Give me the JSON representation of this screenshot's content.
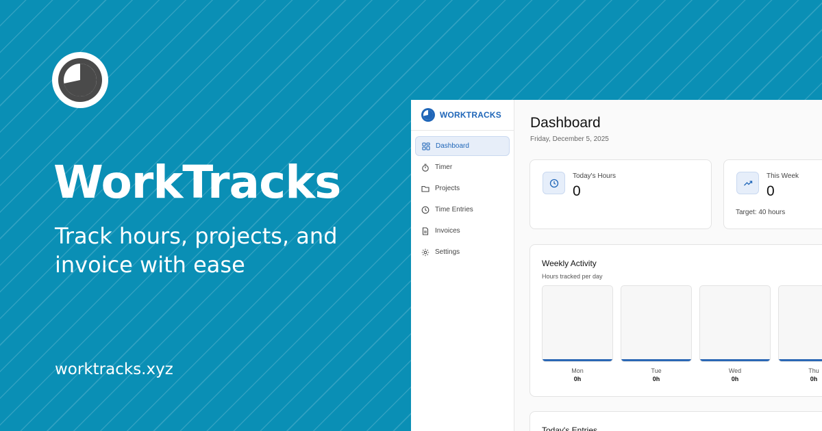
{
  "promo": {
    "brand": "WorkTracks",
    "tagline": "Track hours, projects, and invoice with ease",
    "site": "worktracks.xyz",
    "logo_icon": "clock-logo-icon"
  },
  "app": {
    "sidebar": {
      "title": "WORKTRACKS",
      "items": [
        {
          "label": "Dashboard",
          "icon": "grid-icon",
          "active": true
        },
        {
          "label": "Timer",
          "icon": "stopwatch-icon"
        },
        {
          "label": "Projects",
          "icon": "folder-icon"
        },
        {
          "label": "Time Entries",
          "icon": "clock-icon"
        },
        {
          "label": "Invoices",
          "icon": "document-icon"
        },
        {
          "label": "Settings",
          "icon": "gear-icon"
        }
      ]
    },
    "header": {
      "title": "Dashboard",
      "date": "Friday, December 5, 2025"
    },
    "stats": [
      {
        "label": "Today's Hours",
        "value": "0",
        "icon": "clock-icon"
      },
      {
        "label": "This Week",
        "value": "0",
        "sub": "Target: 40 hours",
        "icon": "trend-up-icon"
      }
    ],
    "weekly": {
      "title": "Weekly Activity",
      "subtitle": "Hours tracked per day",
      "days": [
        {
          "label": "Mon",
          "value": "0h"
        },
        {
          "label": "Tue",
          "value": "0h"
        },
        {
          "label": "Wed",
          "value": "0h"
        },
        {
          "label": "Thu",
          "value": "0h"
        }
      ]
    },
    "entries": {
      "title": "Today's Entries"
    },
    "colors": {
      "background": "#0a8fb5",
      "accent": "#1f66b8",
      "logo_dark": "#4a4a4a"
    }
  }
}
